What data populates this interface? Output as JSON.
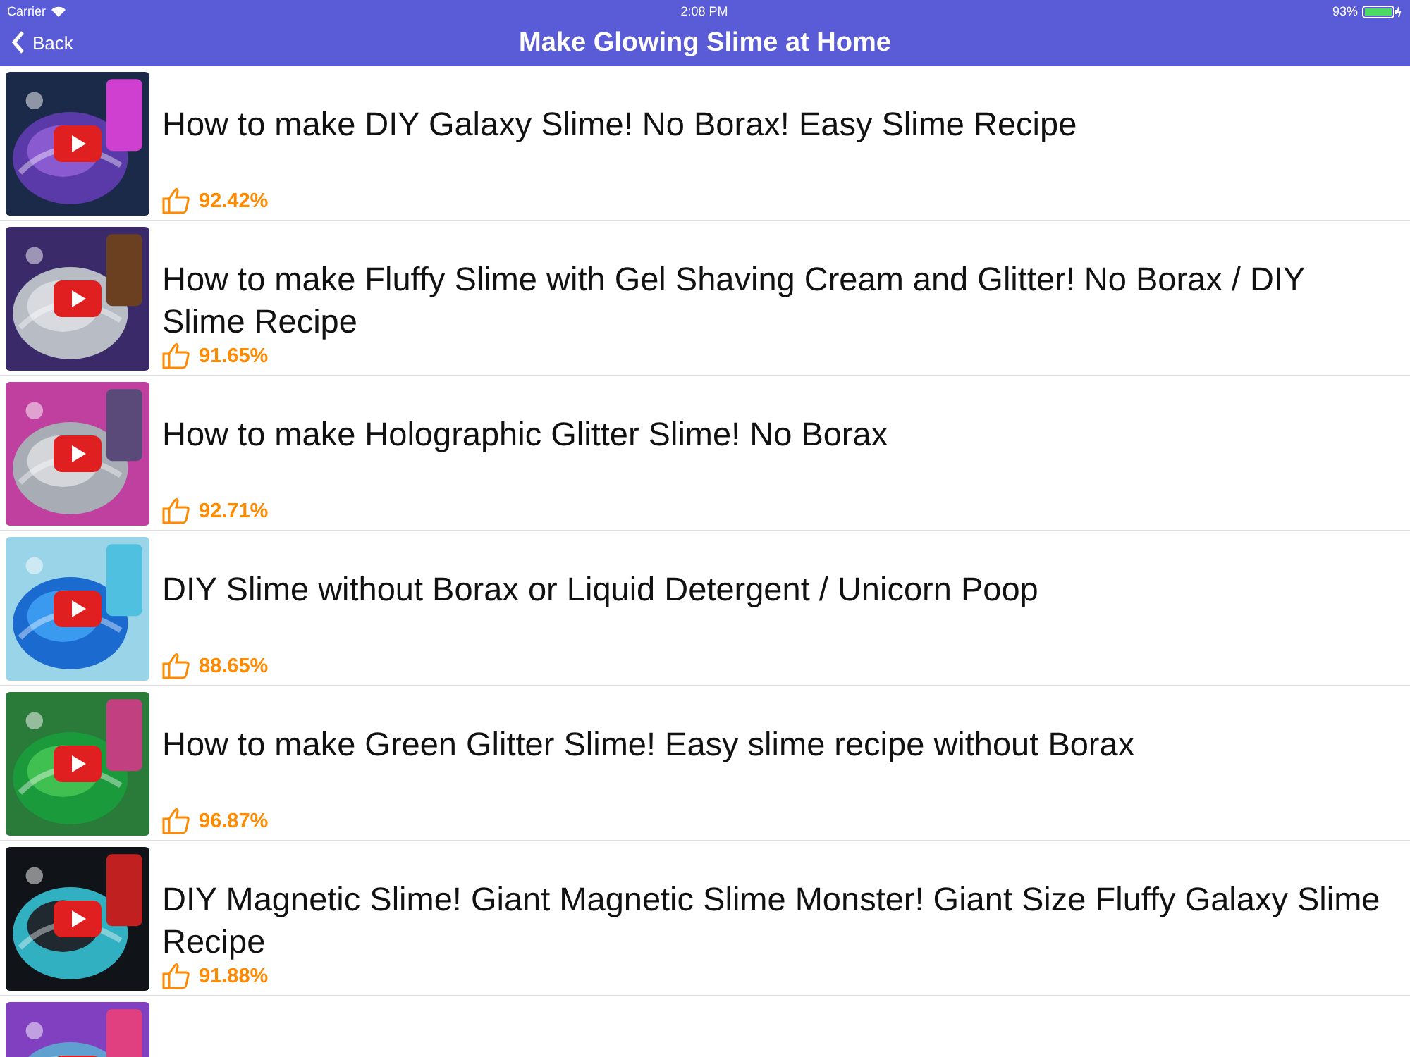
{
  "status_bar": {
    "carrier": "Carrier",
    "time": "2:08 PM",
    "battery": "93%"
  },
  "nav_bar": {
    "back": "Back",
    "title": "Make Glowing Slime at Home"
  },
  "videos": [
    {
      "title": "How to make DIY Galaxy Slime! No Borax!  Easy Slime Recipe",
      "rating": "92.42%",
      "thumbnail": {
        "kind": "picture"
      }
    },
    {
      "title": "How to make Fluffy Slime with Gel Shaving Cream and Glitter! No Borax / DIY Slime Recipe",
      "rating": "91.65%",
      "thumbnail": {
        "kind": "picture"
      }
    },
    {
      "title": "How to make Holographic Glitter Slime! No Borax",
      "rating": "92.71%",
      "thumbnail": {
        "kind": "picture"
      }
    },
    {
      "title": "DIY Slime without Borax or Liquid Detergent / Unicorn Poop",
      "rating": "88.65%",
      "thumbnail": {
        "kind": "picture"
      }
    },
    {
      "title": "How to make Green Glitter Slime! Easy slime recipe without Borax",
      "rating": "96.87%",
      "thumbnail": {
        "kind": "picture"
      }
    },
    {
      "title": "DIY Magnetic Slime! Giant Magnetic Slime Monster! Giant Size Fluffy Galaxy Slime Recipe",
      "rating": "91.88%",
      "thumbnail": {
        "kind": "picture"
      }
    },
    {
      "thumbnail": {
        "kind": "picture"
      }
    }
  ]
}
